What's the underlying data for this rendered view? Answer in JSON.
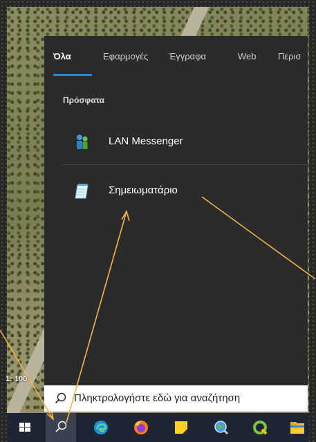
{
  "tabs": [
    {
      "label": "Όλα",
      "active": true
    },
    {
      "label": "Εφαρμογές",
      "active": false
    },
    {
      "label": "Έγγραφα",
      "active": false
    },
    {
      "label": "Web",
      "active": false
    },
    {
      "label": "Περισ",
      "active": false
    }
  ],
  "section_title": "Πρόσφατα",
  "recent_items": [
    {
      "label": "LAN Messenger",
      "icon": "lan-messenger-icon"
    },
    {
      "label": "Σημειωματάριο",
      "icon": "notepad-icon"
    }
  ],
  "search": {
    "placeholder": "Πληκτρολογήστε εδώ για αναζήτηση"
  },
  "map_scale": "1: 100",
  "taskbar": {
    "icons": [
      "windows-start-icon",
      "search-icon",
      "edge-icon",
      "firefox-icon",
      "sticky-notes-icon",
      "search-globe-icon",
      "qgis-icon",
      "file-explorer-icon"
    ]
  },
  "colors": {
    "accent": "#2b88d8",
    "annotation": "#f4b24a",
    "panel": "#2b2b2b",
    "taskbar": "#1f2633"
  }
}
